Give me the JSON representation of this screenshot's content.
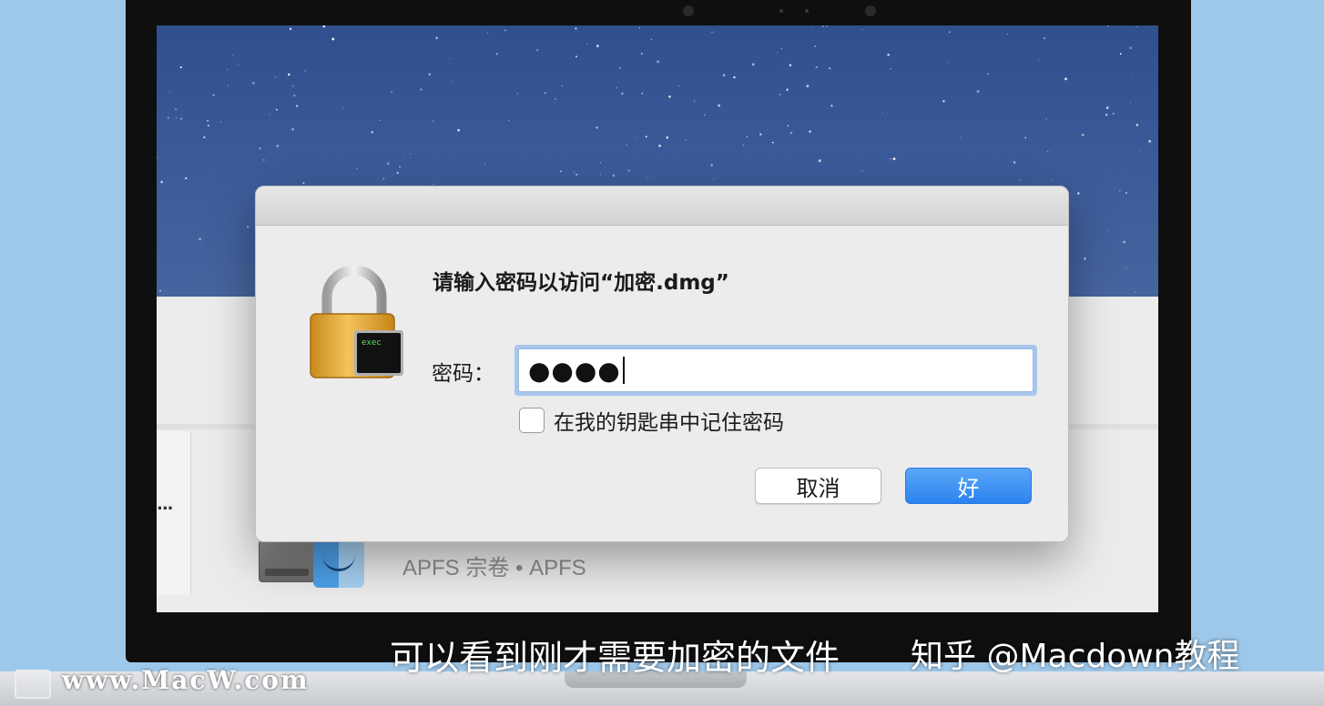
{
  "dialog": {
    "title": "请输入密码以访问“加密.dmg”",
    "password_label": "密码：",
    "password_value": "●●●●",
    "remember_label": "在我的钥匙串中记住密码",
    "remember_checked": false,
    "cancel_label": "取消",
    "ok_label": "好",
    "lock_badge_text": "exec",
    "accent_color": "#2b83ef"
  },
  "background_window": {
    "ellipsis": "...",
    "volume_label": "APFS 宗卷 • APFS"
  },
  "overlay": {
    "subtitle": "可以看到刚才需要加密的文件",
    "zhihu_credit": "知乎 @Macdown教程",
    "watermark": "www.MacW.com"
  }
}
